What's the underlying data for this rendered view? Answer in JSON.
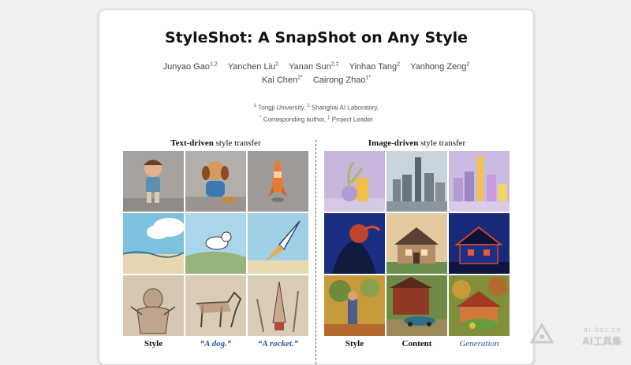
{
  "page": {
    "title": "StyleShot: A SnapShot on Any Style"
  },
  "authors_line1": [
    {
      "name": "Junyao Gao",
      "sup": "1,2"
    },
    {
      "name": "Yanchen Liu",
      "sup": "2"
    },
    {
      "name": "Yanan Sun",
      "sup": "2,‡"
    },
    {
      "name": "Yinhao Tang",
      "sup": "2"
    },
    {
      "name": "Yanhong Zeng",
      "sup": "2"
    }
  ],
  "authors_line2": [
    {
      "name": "Kai Chen",
      "sup": "2*"
    },
    {
      "name": "Cairong Zhao",
      "sup": "1*"
    }
  ],
  "affiliations": {
    "line1_sup1": "1",
    "line1_text1": " Tongji University, ",
    "line1_sup2": "2",
    "line1_text2": " Shanghai AI Laboratory,",
    "line2_sup1": "*",
    "line2_text1": " Corresponding author, ",
    "line2_sup2": "‡",
    "line2_text2": " Project Leader"
  },
  "figure": {
    "left_title_bold": "Text-driven",
    "left_title_rest": " style transfer",
    "right_title_bold": "Image-driven",
    "right_title_rest": " style transfer",
    "left_captions": [
      "Style",
      "“A dog.”",
      "“A rocket.”"
    ],
    "right_captions": [
      "Style",
      "Content",
      "Generation"
    ]
  },
  "watermark": {
    "url": "ai-bot.cn",
    "name": "AI工具集"
  }
}
